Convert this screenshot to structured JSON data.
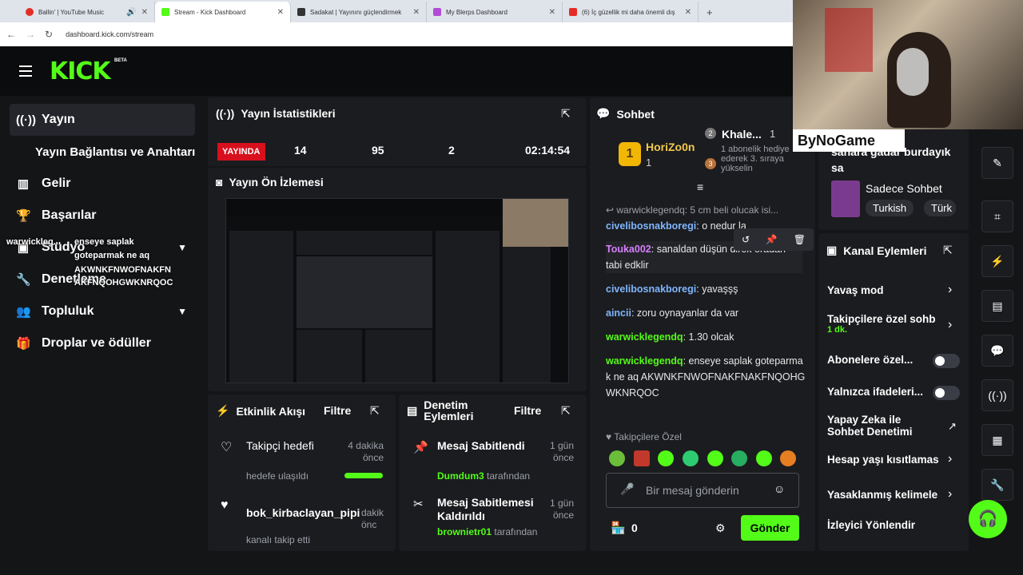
{
  "browser": {
    "tabs": [
      {
        "title": "Ballin' | YouTube Music",
        "color": "#e52d27"
      },
      {
        "title": "Stream - Kick Dashboard",
        "color": "#53fc18"
      },
      {
        "title": "Sadakat | Yayınını güçlendirmek",
        "color": "#333"
      },
      {
        "title": "My Blerps Dashboard",
        "color": "#b14cd6"
      },
      {
        "title": "(6) İç güzellik mi daha önemli dış",
        "color": "#e52d27"
      }
    ],
    "url": "dashboard.kick.com/stream"
  },
  "logo": {
    "text": "KICK",
    "beta": "BETA"
  },
  "sidebar": {
    "items": [
      {
        "label": "Yayın"
      },
      {
        "label": "Yayın Bağlantısı ve Anahtarı"
      },
      {
        "label": "Gelir"
      },
      {
        "label": "Başarılar"
      },
      {
        "label": "Stüdyo"
      },
      {
        "label": "Denetleme"
      },
      {
        "label": "Topluluk"
      },
      {
        "label": "Droplar ve ödüller"
      }
    ]
  },
  "overlay_chat": {
    "user": "warwickleg...",
    "msg1": "enseye saplak",
    "msg2": "goteparmak ne aq",
    "msg3": "AKWNKFNWOFNAKFN",
    "msg4": "AKFNQOHGWKNRQOC"
  },
  "stats": {
    "title": "Yayın İstatistikleri",
    "badge": "YAYINDA",
    "v1": "14",
    "v2": "95",
    "v3": "2",
    "time": "02:14:54"
  },
  "preview": {
    "title": "Yayın Ön İzlemesi"
  },
  "activity": {
    "title": "Etkinlik Akışı",
    "filter": "Filtre",
    "items": [
      {
        "title": "Takipçi hedefi",
        "time": "4 dakika önce",
        "sub": "hedefe ulaşıldı"
      },
      {
        "title": "bok_kirbaclayan_pipi",
        "time": "dakik önc",
        "sub": "kanalı takip etti"
      }
    ]
  },
  "moderation": {
    "title": "Denetim Eylemleri",
    "filter": "Filtre",
    "items": [
      {
        "title": "Mesaj Sabitlendi",
        "time": "1 gün önce",
        "user": "Dumdum3",
        "suffix": "tarafından"
      },
      {
        "title": "Mesaj Sabitlemesi Kaldırıldı",
        "time": "1 gün önce",
        "user": "brownietr01",
        "suffix": "tarafından"
      }
    ]
  },
  "chat": {
    "title": "Sohbet",
    "top1": {
      "rank": "1",
      "name": "HoriZo0n",
      "count": "1"
    },
    "top2": {
      "rank": "2",
      "name": "Khale...",
      "count": "1"
    },
    "top3": {
      "rank": "3",
      "text": "1 abonelik hediye ederek 3. sıraya yükselin"
    },
    "reply": "warwicklegendq: 5 cm beli olucak isi...",
    "messages": [
      {
        "user": "civelibosnakboregi",
        "text": "o nedur la",
        "color": "#7fb6ff"
      },
      {
        "user": "Touka002",
        "text": "sanaldan düşün direk oradan tabi edklir",
        "color": "#d77fff"
      },
      {
        "user": "civelibosnakboregi",
        "text": "yavaşşş",
        "color": "#7fb6ff"
      },
      {
        "user": "aincii",
        "text": "zoru oynayanlar da var",
        "color": "#7fb6ff"
      },
      {
        "user": "warwicklegendq",
        "text": "1.30 olcak",
        "color": "#53fc18"
      },
      {
        "user": "warwicklegendq",
        "text": "enseye saplak goteparmak ne aq AKWNKFNWOFNAKFNAKFNQOHGWKNRQOC",
        "color": "#53fc18"
      }
    ],
    "emote_label": "Takipçilere Özel",
    "placeholder": "Bir mesaj gönderin",
    "points": "0",
    "send": "Gönder"
  },
  "stream_info": {
    "partial": "sahara gadar burdayık sa",
    "mode": "Sadece Sohbet",
    "tags": [
      "Turkish",
      "Türk"
    ],
    "watermark": "ByNoGame"
  },
  "actions": {
    "title": "Kanal Eylemleri",
    "items": [
      {
        "label": "Yavaş mod"
      },
      {
        "label": "Takipçilere özel sohb",
        "sub": "1 dk."
      },
      {
        "label": "Abonelere özel..."
      },
      {
        "label": "Yalnızca ifadeleri..."
      },
      {
        "label": "Yapay Zeka ile Sohbet Denetimi"
      },
      {
        "label": "Hesap yaşı kısıtlamas"
      },
      {
        "label": "Yasaklanmış kelimele"
      },
      {
        "label": "İzleyici Yönlendir"
      }
    ]
  }
}
